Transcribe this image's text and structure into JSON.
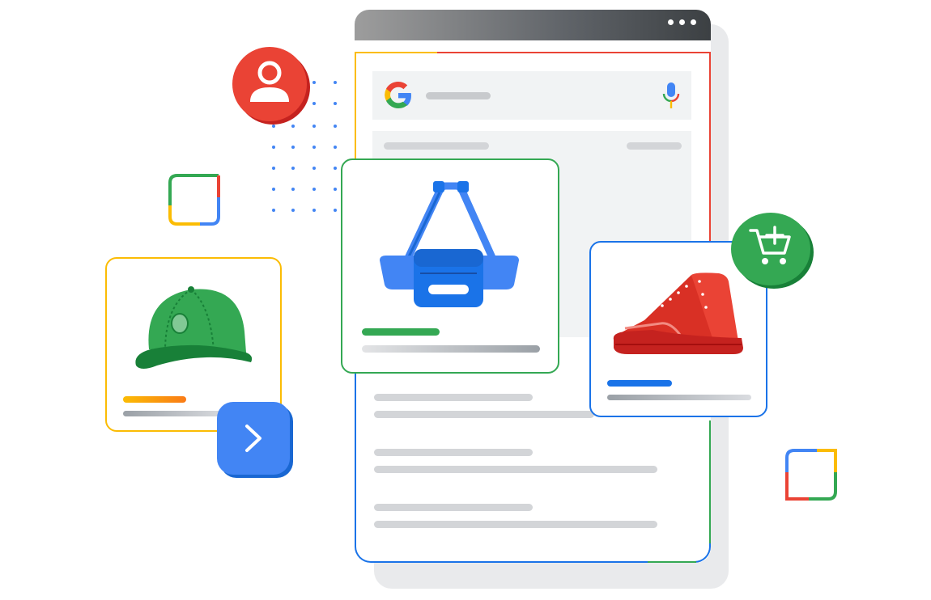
{
  "colors": {
    "google_blue": "#4285f4",
    "google_red": "#ea4335",
    "google_yellow": "#fbbc04",
    "google_green": "#34a853",
    "placeholder_gray": "#d3d5d8",
    "window_bar": "#5f6368"
  },
  "window": {
    "menu_icon": "more-horizontal-icon"
  },
  "search": {
    "logo": "google-g-logo",
    "voice_icon": "microphone-icon"
  },
  "products": [
    {
      "name": "bag",
      "icon": "shoulder-bag-icon",
      "accent": "#34a853"
    },
    {
      "name": "shoe",
      "icon": "red-sneaker-icon",
      "accent": "#1a73e8"
    },
    {
      "name": "cap",
      "icon": "green-cap-icon",
      "accent": "#fbbc04"
    }
  ],
  "badges": {
    "user": "person-avatar-icon",
    "cart": "add-to-cart-icon",
    "next": "chevron-right-icon"
  }
}
